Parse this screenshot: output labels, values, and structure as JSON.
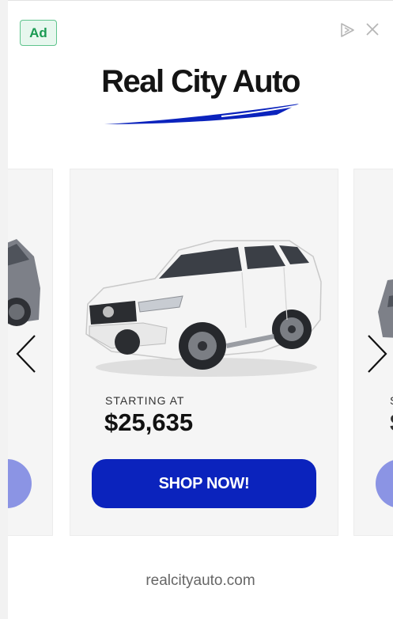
{
  "ad": {
    "badge": "Ad",
    "brand": "Real City Auto",
    "domain": "realcityauto.com"
  },
  "product": {
    "starting_label": "STARTING AT",
    "price": "$25,635",
    "cta": "SHOP NOW!"
  },
  "peek": {
    "right_label_initial": "S",
    "right_price_initial": "$"
  },
  "colors": {
    "cta": "#0b23bd",
    "cta_faded": "#8b94e4",
    "badge_green": "#1a9a52",
    "swoosh": "#0b23bd"
  },
  "icons": {
    "adchoices": "adchoices-icon",
    "close": "close-icon",
    "prev": "chevron-left-icon",
    "next": "chevron-right-icon"
  }
}
